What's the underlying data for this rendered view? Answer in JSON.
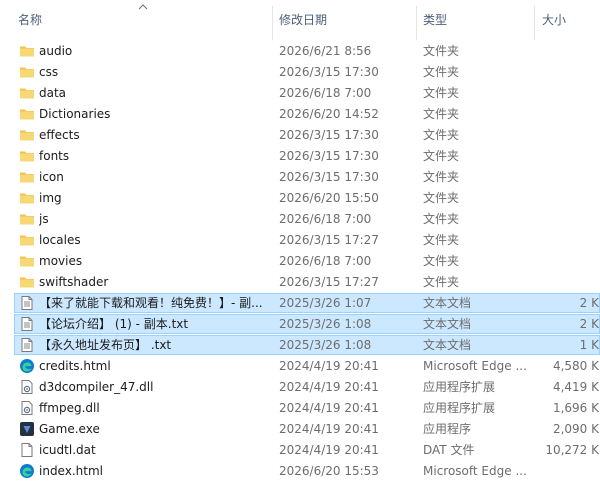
{
  "columns": {
    "name": "名称",
    "date": "修改日期",
    "type": "类型",
    "size": "大小"
  },
  "files": [
    {
      "name": "audio",
      "date": "2026/6/21 8:56",
      "type": "文件夹",
      "size": "",
      "icon": "folder-icon",
      "selected": false
    },
    {
      "name": "css",
      "date": "2026/3/15 17:30",
      "type": "文件夹",
      "size": "",
      "icon": "folder-icon",
      "selected": false
    },
    {
      "name": "data",
      "date": "2026/6/18 7:00",
      "type": "文件夹",
      "size": "",
      "icon": "folder-icon",
      "selected": false
    },
    {
      "name": "Dictionaries",
      "date": "2026/6/20 14:52",
      "type": "文件夹",
      "size": "",
      "icon": "folder-icon",
      "selected": false
    },
    {
      "name": "effects",
      "date": "2026/3/15 17:30",
      "type": "文件夹",
      "size": "",
      "icon": "folder-icon",
      "selected": false
    },
    {
      "name": "fonts",
      "date": "2026/3/15 17:30",
      "type": "文件夹",
      "size": "",
      "icon": "folder-icon",
      "selected": false
    },
    {
      "name": "icon",
      "date": "2026/3/15 17:30",
      "type": "文件夹",
      "size": "",
      "icon": "folder-icon",
      "selected": false
    },
    {
      "name": "img",
      "date": "2026/6/20 15:50",
      "type": "文件夹",
      "size": "",
      "icon": "folder-icon",
      "selected": false
    },
    {
      "name": "js",
      "date": "2026/6/18 7:00",
      "type": "文件夹",
      "size": "",
      "icon": "folder-icon",
      "selected": false
    },
    {
      "name": "locales",
      "date": "2026/3/15 17:27",
      "type": "文件夹",
      "size": "",
      "icon": "folder-icon",
      "selected": false
    },
    {
      "name": "movies",
      "date": "2026/6/18 7:00",
      "type": "文件夹",
      "size": "",
      "icon": "folder-icon",
      "selected": false
    },
    {
      "name": "swiftshader",
      "date": "2026/3/15 17:27",
      "type": "文件夹",
      "size": "",
      "icon": "folder-icon",
      "selected": false
    },
    {
      "name": "【来了就能下载和观看！纯免费！】- 副...",
      "date": "2025/3/26 1:07",
      "type": "文本文档",
      "size": "2 K",
      "icon": "text-document-icon",
      "selected": true
    },
    {
      "name": "【论坛介绍】 (1) - 副本.txt",
      "date": "2025/3/26 1:08",
      "type": "文本文档",
      "size": "2 K",
      "icon": "text-document-icon",
      "selected": true
    },
    {
      "name": "【永久地址发布页】 .txt",
      "date": "2025/3/26 1:08",
      "type": "文本文档",
      "size": "1 K",
      "icon": "text-document-icon",
      "selected": true
    },
    {
      "name": "credits.html",
      "date": "2024/4/19 20:41",
      "type": "Microsoft Edge ...",
      "size": "4,580 K",
      "icon": "edge-icon",
      "selected": false
    },
    {
      "name": "d3dcompiler_47.dll",
      "date": "2024/4/19 20:41",
      "type": "应用程序扩展",
      "size": "4,419 K",
      "icon": "dll-icon",
      "selected": false
    },
    {
      "name": "ffmpeg.dll",
      "date": "2024/4/19 20:41",
      "type": "应用程序扩展",
      "size": "1,696 K",
      "icon": "dll-icon",
      "selected": false
    },
    {
      "name": "Game.exe",
      "date": "2024/4/19 20:41",
      "type": "应用程序",
      "size": "2,090 K",
      "icon": "game-exe-icon",
      "selected": false
    },
    {
      "name": "icudtl.dat",
      "date": "2024/4/19 20:41",
      "type": "DAT 文件",
      "size": "10,272 K",
      "icon": "dat-file-icon",
      "selected": false
    },
    {
      "name": "index.html",
      "date": "2026/6/20 15:53",
      "type": "Microsoft Edge ...",
      "size": "",
      "icon": "edge-icon",
      "selected": false
    }
  ],
  "colors": {
    "selected_bg": "#cce8ff",
    "selected_border": "#99d1ff",
    "folder": "#f8d775",
    "header_text": "#4c607a",
    "secondary_text": "#6d6d6d"
  }
}
